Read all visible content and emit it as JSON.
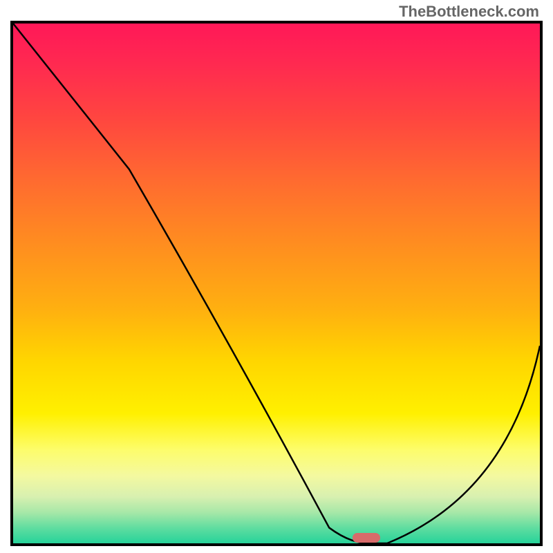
{
  "watermark": "TheBottleneck.com",
  "chart_data": {
    "type": "line",
    "title": "",
    "xlabel": "",
    "ylabel": "",
    "x_range": [
      0,
      100
    ],
    "y_range": [
      0,
      100
    ],
    "series": [
      {
        "name": "curve",
        "points": [
          {
            "x": 0,
            "y": 100
          },
          {
            "x": 22,
            "y": 72
          },
          {
            "x": 60,
            "y": 3
          },
          {
            "x": 64,
            "y": 0
          },
          {
            "x": 71,
            "y": 0
          },
          {
            "x": 100,
            "y": 38
          }
        ]
      }
    ],
    "marker": {
      "x_pct": 67,
      "y_pct": 99
    },
    "gradient_stops": [
      {
        "pos": 0,
        "color": "#ff1858"
      },
      {
        "pos": 50,
        "color": "#ffb010"
      },
      {
        "pos": 80,
        "color": "#fff000"
      },
      {
        "pos": 100,
        "color": "#26d39a"
      }
    ]
  }
}
